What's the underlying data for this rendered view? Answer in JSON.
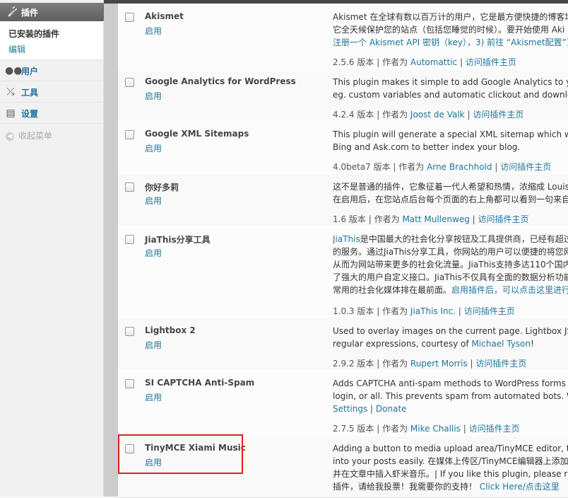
{
  "menu": {
    "head_label": "插件",
    "submenu_current": "已安装的插件",
    "submenu_edit": "编辑",
    "items": [
      {
        "label": "用户",
        "icon": "users-icon"
      },
      {
        "label": "工具",
        "icon": "tools-icon"
      },
      {
        "label": "设置",
        "icon": "settings-icon"
      }
    ],
    "collapse": "收起菜单"
  },
  "plugins": [
    {
      "name": "Akismet",
      "enable": "启用",
      "desc": [
        "Akismet 在全球有数以百万计的用户，它是最方便快捷的博客垃",
        "它全天候保护您的站点（包括您睡觉的时候）。要开始使用 Aki",
        "注册一个 Akismet API 密钥（key），3) 前往 “Akismet配置”页面"
      ],
      "version": "2.5.6 版本",
      "author_prefix": "作者为",
      "author": "Automattic",
      "visit": "访问插件主页"
    },
    {
      "name": "Google Analytics for WordPress",
      "enable": "启用",
      "desc": [
        "This plugin makes it simple to add Google Analytics to your W",
        "eg. custom variables and automatic clickout and download trac"
      ],
      "version": "4.2.4 版本",
      "author_prefix": "作者为",
      "author": "Joost de Valk",
      "visit": "访问插件主页"
    },
    {
      "name": "Google XML Sitemaps",
      "enable": "启用",
      "desc": [
        "This plugin will generate a special XML sitemap which will help",
        "Bing and Ask.com to better index your blog."
      ],
      "version": "4.0beta7 版本",
      "author_prefix": "作者为",
      "author": "Arne Brachhold",
      "visit": "访问插件主页"
    },
    {
      "name": "你好多莉",
      "enable": "启用",
      "desc": [
        "这不是普通的插件，它象征着一代人希望和热情，浓缩成 Louis",
        "在启用后，在您站点后台每个页面的右上角都可以看到一句来自"
      ],
      "version": "1.6 版本",
      "author_prefix": "作者为",
      "author": "Matt Mullenweg",
      "visit": "访问插件主页"
    },
    {
      "name": "JiaThis分享工具",
      "enable": "启用",
      "desc_link": "JiaThis",
      "desc": [
        "是中国最大的社会化分享按钮及工具提供商，已经有超过",
        "的服务。通过JiaThis分享工具，你网站的用户可以便捷的将您网",
        "从而为网站带来更多的社会化流量。JiaThis支持多达110个国内",
        "了强大的用户自定义接口。JiaThis不仅具有全面的数据分析功能",
        "常用的社会化媒体排在最前面。"
      ],
      "desc_tail_link": "启用插件后，可以点击这里进行",
      "version": "1.0.3 版本",
      "author_prefix": "作者为",
      "author": "JiaThis Inc.",
      "visit": "访问插件主页"
    },
    {
      "name": "Lightbox 2",
      "enable": "启用",
      "desc": [
        "Used to overlay images on the current page. Lightbox JS v2.2",
        "regular expressions, courtesy of"
      ],
      "desc_link": "Michael Tyson",
      "version": "2.9.2 版本",
      "author_prefix": "作者为",
      "author": "Rupert Morris",
      "visit": "访问插件主页"
    },
    {
      "name": "SI CAPTCHA Anti-Spam",
      "enable": "启用",
      "desc": [
        "Adds CAPTCHA anti-spam methods to WordPress forms for co",
        "login, or all. This prevents spam from automated bots. WP, WP"
      ],
      "settings": "Settings",
      "donate": "Donate",
      "version": "2.7.5 版本",
      "author_prefix": "作者为",
      "author": "Mike Challis",
      "visit": "访问插件主页"
    },
    {
      "name": "TinyMCE Xiami Music",
      "enable": "启用",
      "desc": [
        "Adding a button to media upload area/TinyMCE editor, than yo",
        "into your posts easily. 在媒体上传区/TinyMCE编辑器上添加一个",
        "并在文章中插入虾米音乐。| If you like this plugin, please rate! I",
        "插件，请给我投票！我需要你的支持！"
      ],
      "desc_link": "Click Here/点击这里"
    }
  ]
}
